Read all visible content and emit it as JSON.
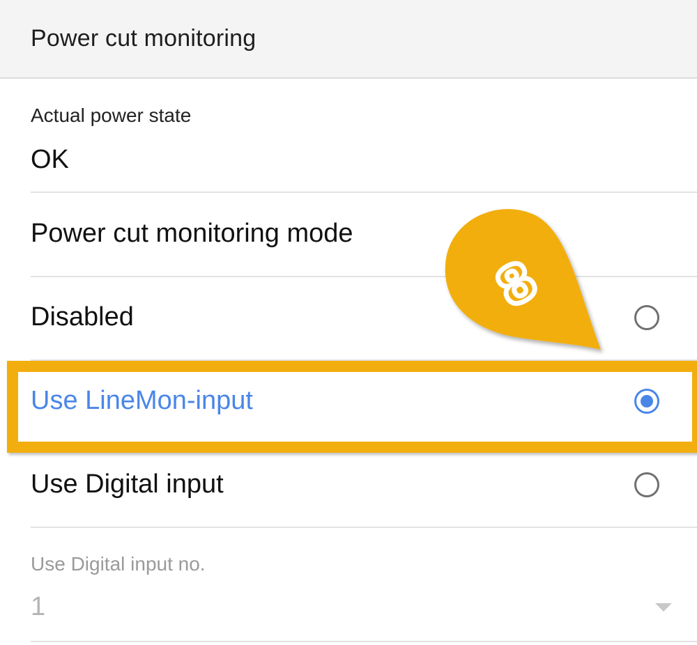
{
  "header": {
    "title": "Power cut monitoring"
  },
  "actual_power_state": {
    "label": "Actual power state",
    "value": "OK"
  },
  "mode_section": {
    "title": "Power cut monitoring mode",
    "options": [
      {
        "label": "Disabled",
        "selected": false
      },
      {
        "label": "Use LineMon-input",
        "selected": true
      },
      {
        "label": "Use Digital input",
        "selected": false
      }
    ]
  },
  "digital_input_no": {
    "label": "Use Digital input no.",
    "value": "1",
    "enabled": false
  },
  "annotation": {
    "callout_number": "8",
    "callout_color": "#f2ae0e",
    "highlight_color": "#f2ae0e"
  },
  "colors": {
    "accent": "#4a86e8",
    "header_bg": "#f4f4f4",
    "disabled_text": "#9a9a9a"
  }
}
